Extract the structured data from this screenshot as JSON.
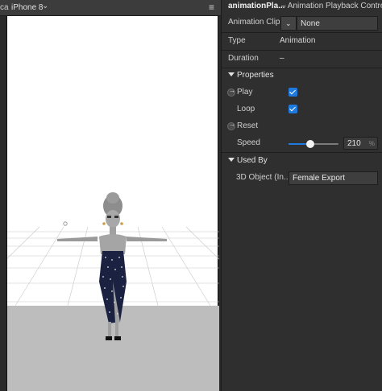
{
  "viewport": {
    "truncated_label": "ca",
    "device": "iPhone 8",
    "dropdown_glyph": "⌄",
    "menu_glyph": "≡"
  },
  "inspector": {
    "name": "animationPla...",
    "type_subtitle": "– Animation Playback Controller",
    "rows": {
      "clip_label": "Animation Clip",
      "clip_value": "None",
      "type_label": "Type",
      "type_value": "Animation",
      "duration_label": "Duration",
      "duration_value": "–"
    },
    "properties": {
      "section_label": "Properties",
      "play_label": "Play",
      "play_checked": true,
      "loop_label": "Loop",
      "loop_checked": true,
      "reset_label": "Reset",
      "speed_label": "Speed",
      "speed_value": "210",
      "speed_unit": "%",
      "speed_slider_fraction": 0.43
    },
    "used_by": {
      "section_label": "Used By",
      "object_label": "3D Object (In...",
      "object_value": "Female Export"
    }
  },
  "colors": {
    "accent": "#1f7ae0",
    "panel_bg": "#2f2f2f",
    "floor": "#bdbdbd"
  }
}
